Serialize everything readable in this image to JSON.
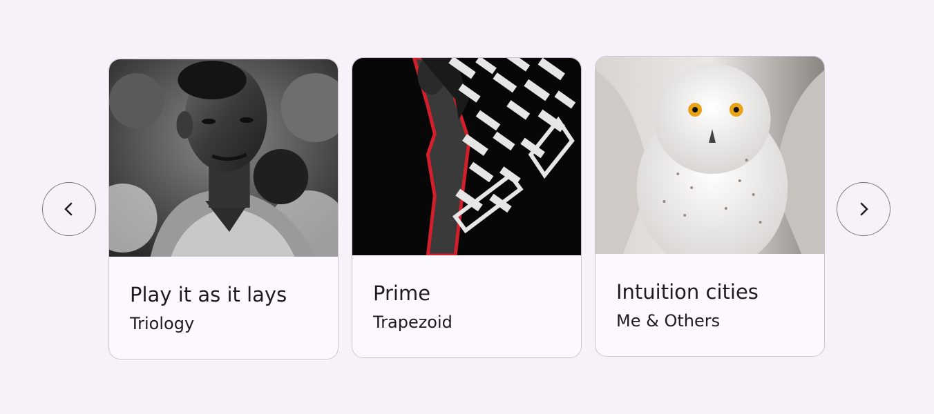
{
  "carousel": {
    "prev_icon": "chevron-left-icon",
    "next_icon": "chevron-right-icon",
    "items": [
      {
        "title": "Play it as it lays",
        "subtitle": "Triology",
        "image": "black-and-white portrait of a man"
      },
      {
        "title": "Prime",
        "subtitle": "Trapezoid",
        "image": "man with red outline and white graphic pattern on black"
      },
      {
        "title": "Intuition cities",
        "subtitle": "Me & Others",
        "image": "snowy owl with yellow eyes"
      }
    ]
  },
  "colors": {
    "background": "#f7f2fa",
    "card_surface": "#fdf7ff",
    "outline": "#cac4d0",
    "button_outline": "#79747e",
    "text": "#1d1b20",
    "accent_red": "#d21f2b"
  }
}
